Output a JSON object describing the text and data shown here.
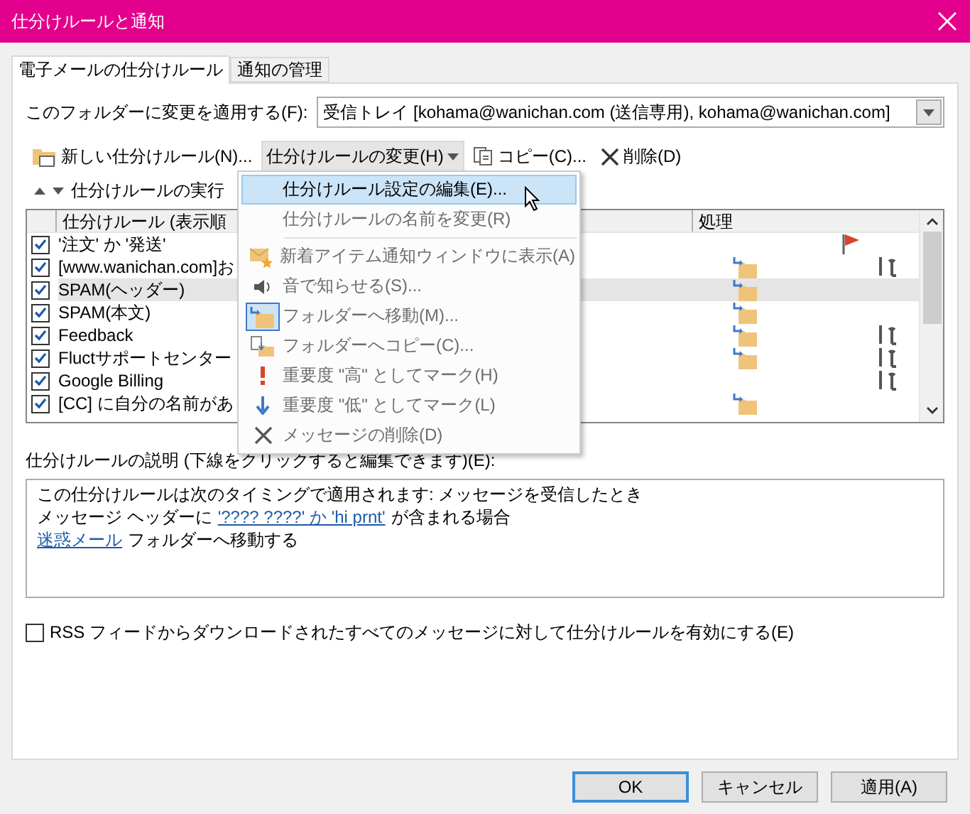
{
  "window": {
    "title": "仕分けルールと通知"
  },
  "tabs": [
    {
      "label": "電子メールの仕分けルール",
      "selected": true
    },
    {
      "label": "通知の管理",
      "selected": false
    }
  ],
  "folder_field": {
    "label": "このフォルダーに変更を適用する(F):",
    "value": "受信トレイ [kohama@wanichan.com (送信専用), kohama@wanichan.com]"
  },
  "toolbar": [
    {
      "kind": "new",
      "label": "新しい仕分けルール(N)..."
    },
    {
      "kind": "menu",
      "label": "仕分けルールの変更(H)",
      "expanded": true
    },
    {
      "kind": "copy",
      "label": "コピー(C)..."
    },
    {
      "kind": "delete",
      "label": "削除(D)"
    }
  ],
  "run_label": "仕分けルールの実行",
  "table": {
    "columns": [
      "仕分けルール (表示順",
      "処理"
    ],
    "rows": [
      {
        "name": "'注文' か '発送'",
        "checked": true,
        "selected": false,
        "flag": true,
        "move": false,
        "tools": false
      },
      {
        "name": "[www.wanichan.com]お",
        "checked": true,
        "selected": false,
        "flag": false,
        "move": true,
        "tools": true
      },
      {
        "name": "SPAM(ヘッダー)",
        "checked": true,
        "selected": true,
        "flag": false,
        "move": true,
        "tools": false
      },
      {
        "name": "SPAM(本文)",
        "checked": true,
        "selected": false,
        "flag": false,
        "move": true,
        "tools": false
      },
      {
        "name": "Feedback",
        "checked": true,
        "selected": false,
        "flag": false,
        "move": true,
        "tools": true
      },
      {
        "name": "Fluctサポートセンター",
        "checked": true,
        "selected": false,
        "flag": false,
        "move": true,
        "tools": true
      },
      {
        "name": "Google Billing",
        "checked": true,
        "selected": false,
        "flag": false,
        "move": false,
        "tools": true
      },
      {
        "name": "[CC] に自分の名前があ",
        "checked": true,
        "selected": false,
        "flag": false,
        "move": true,
        "tools": false
      }
    ]
  },
  "menu": {
    "groups": [
      [
        {
          "kind": "none",
          "label": "仕分けルール設定の編集(E)...",
          "selected": true,
          "disabled": false
        },
        {
          "kind": "none",
          "label": "仕分けルールの名前を変更(R)",
          "selected": false,
          "disabled": true
        }
      ],
      [
        {
          "kind": "notify",
          "label": "新着アイテム通知ウィンドウに表示(A)",
          "selected": false,
          "disabled": true
        },
        {
          "kind": "sound",
          "label": "音で知らせる(S)...",
          "selected": false,
          "disabled": true
        },
        {
          "kind": "move",
          "label": "フォルダーへ移動(M)...",
          "selected": false,
          "disabled": true
        },
        {
          "kind": "copy",
          "label": "フォルダーへコピー(C)...",
          "selected": false,
          "disabled": true
        },
        {
          "kind": "high",
          "label": "重要度 \"高\" としてマーク(H)",
          "selected": false,
          "disabled": true
        },
        {
          "kind": "low",
          "label": "重要度 \"低\" としてマーク(L)",
          "selected": false,
          "disabled": true
        },
        {
          "kind": "delete",
          "label": "メッセージの削除(D)",
          "selected": false,
          "disabled": true
        }
      ]
    ]
  },
  "description": {
    "label": "仕分けルールの説明 (下線をクリックすると編集できます)(E):",
    "lines": [
      [
        {
          "text": "この仕分けルールは次のタイミングで適用されます: メッセージを受信したとき",
          "link": false
        }
      ],
      [
        {
          "text": "メッセージ ヘッダーに",
          "link": false
        },
        {
          "text": "'???? ????' か 'hi prnt'",
          "link": true
        },
        {
          "text": "が含まれる場合",
          "link": false
        }
      ],
      [
        {
          "text": "迷惑メール",
          "link": true
        },
        {
          "text": "フォルダーへ移動する",
          "link": false
        }
      ]
    ]
  },
  "rss": {
    "label": "RSS フィードからダウンロードされたすべてのメッセージに対して仕分けルールを有効にする(E)",
    "checked": false
  },
  "buttons": [
    {
      "label": "OK",
      "default": true
    },
    {
      "label": "キャンセル",
      "default": false
    },
    {
      "label": "適用(A)",
      "default": false
    }
  ]
}
